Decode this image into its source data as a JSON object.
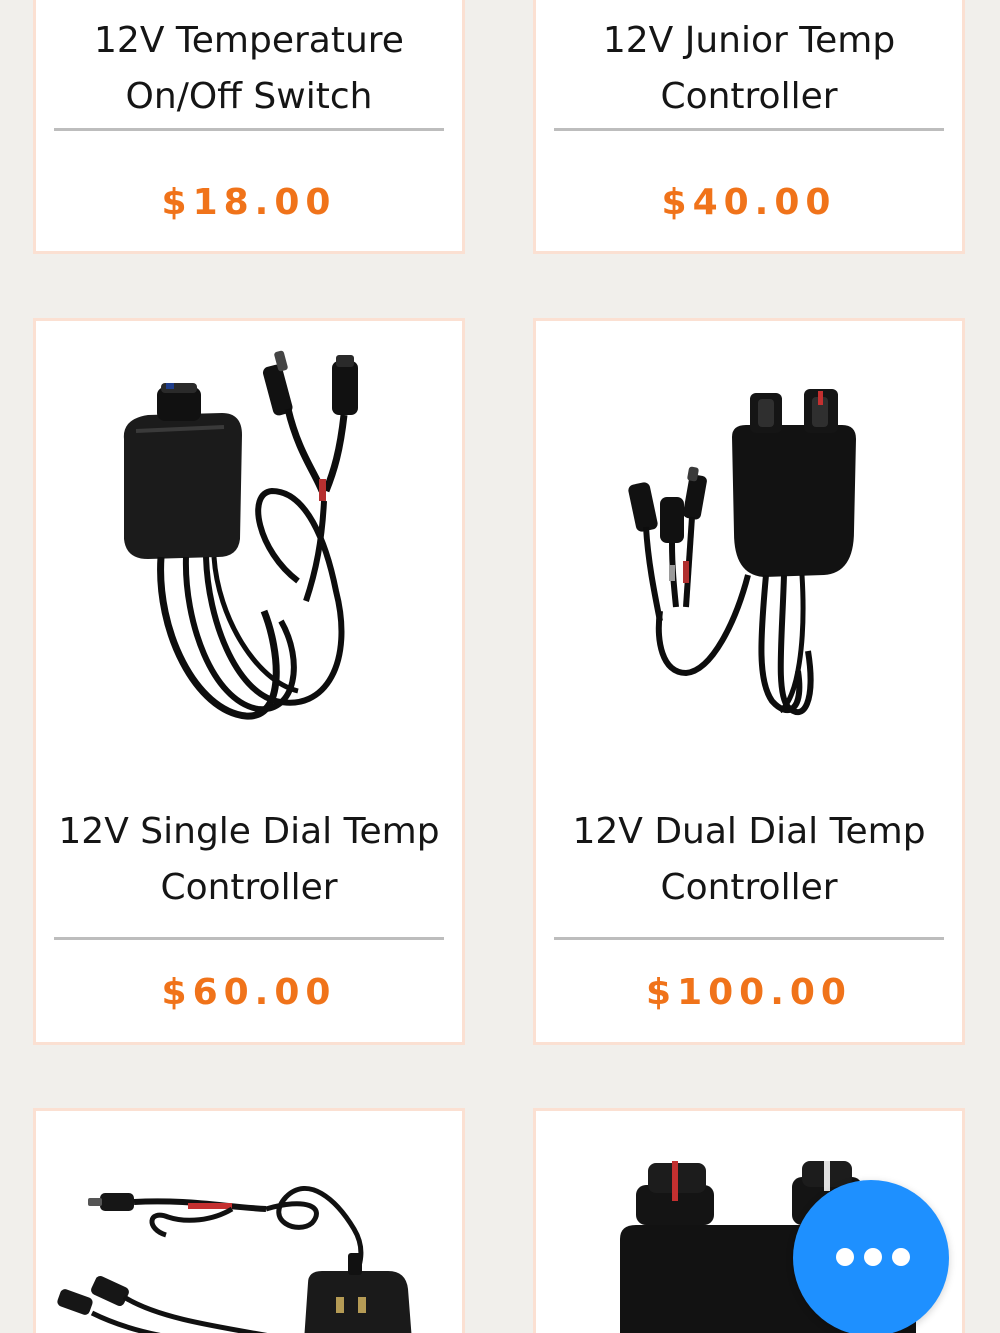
{
  "products": [
    {
      "title_line1": "12V Temperature",
      "title_line2": "On/Off Switch",
      "price": "$18.00"
    },
    {
      "title_line1": "12V Junior Temp",
      "title_line2": "Controller",
      "price": "$40.00"
    },
    {
      "title_line1": "12V Single Dial Temp",
      "title_line2": "Controller",
      "price": "$60.00"
    },
    {
      "title_line1": "12V Dual Dial Temp",
      "title_line2": "Controller",
      "price": "$100.00"
    }
  ],
  "icons": {
    "chat": "more-dots-icon"
  },
  "colors": {
    "price": "#f0731a",
    "card_border": "#fbe0d2",
    "fab": "#1e90ff",
    "page_background": "#f1efeb"
  }
}
